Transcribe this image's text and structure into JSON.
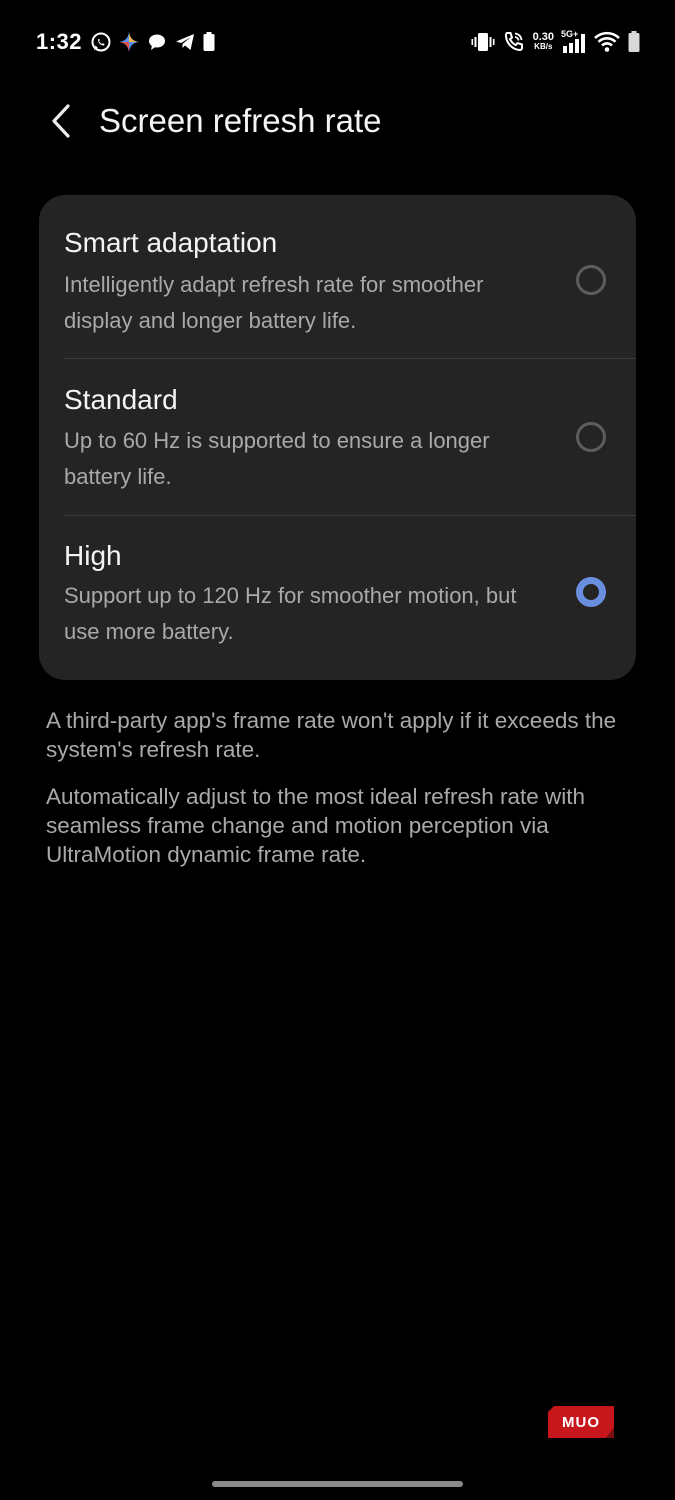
{
  "status_bar": {
    "time": "1:32",
    "net_speed_value": "0.30",
    "net_speed_unit": "KB/s",
    "network_type": "5G+",
    "left_icons": [
      "whatsapp-icon",
      "gemini-sparkle-icon",
      "chat-bubble-icon",
      "telegram-icon",
      "battery-small-icon"
    ],
    "right_icons": [
      "vibrate-icon",
      "wifi-calling-icon",
      "net-speed",
      "cellular-signal-icon",
      "wifi-icon",
      "battery-icon"
    ]
  },
  "header": {
    "title": "Screen refresh rate",
    "back_icon": "chevron-left-icon"
  },
  "options": [
    {
      "title": "Smart adaptation",
      "description": "Intelligently adapt refresh rate for smoother display and longer battery life.",
      "selected": false
    },
    {
      "title": "Standard",
      "description": "Up to 60 Hz is supported to ensure a longer battery life.",
      "selected": false
    },
    {
      "title": "High",
      "description": "Support up to 120 Hz for smoother motion, but use more battery.",
      "selected": true
    }
  ],
  "info": [
    "A third-party app's frame rate won't apply if it exceeds the system's refresh rate.",
    "Automatically adjust to the most ideal refresh rate with seamless frame change and motion perception via UltraMotion dynamic frame rate."
  ],
  "watermark": {
    "text": "MUO"
  },
  "colors": {
    "background": "#000000",
    "card": "#242424",
    "accent": "#6b8fe0",
    "watermark_red": "#c8161d"
  }
}
